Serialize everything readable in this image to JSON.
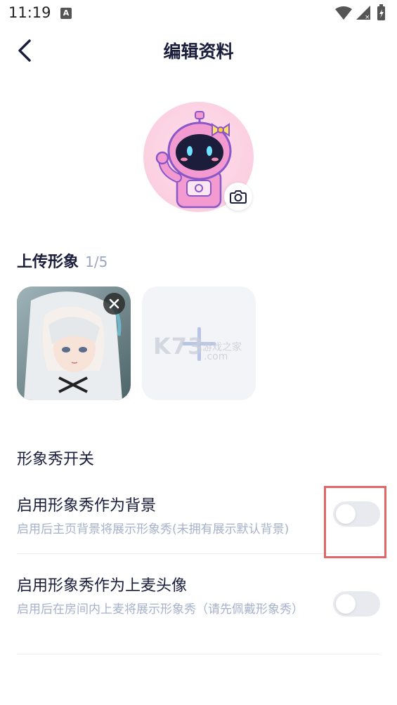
{
  "status_bar": {
    "time": "11:19",
    "notification_icon": "A"
  },
  "nav": {
    "title": "编辑资料",
    "back_icon": "chevron-left-icon"
  },
  "avatar": {
    "camera_icon": "camera-icon"
  },
  "upload": {
    "title": "上传形象",
    "count": "1/5",
    "add_icon": "plus-icon",
    "remove_icon": "close-icon"
  },
  "watermark": {
    "brand": "K73",
    "site": "游戏之家",
    "domain": ".com"
  },
  "show_section": {
    "label": "形象秀开关"
  },
  "settings": [
    {
      "title": "启用形象秀作为背景",
      "desc": "启用后主页背景将展示形象秀(未拥有展示默认背景)",
      "enabled": false
    },
    {
      "title": "启用形象秀作为上麦头像",
      "desc": "启用后在房间内上麦将展示形象秀（请先佩戴形象秀）",
      "enabled": false
    }
  ],
  "colors": {
    "accent_text": "#1a1e3c",
    "muted_text": "#a6b1cc",
    "highlight": "#e06668",
    "toggle_off": "#e8eaf0"
  }
}
